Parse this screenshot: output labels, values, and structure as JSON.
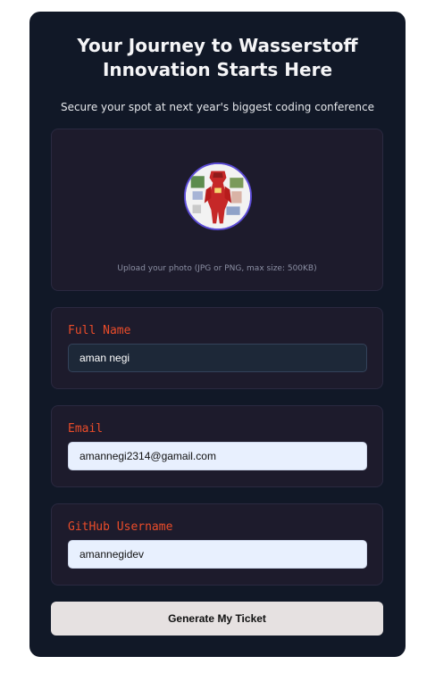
{
  "hero": {
    "title_line1": "Your Journey to Wasserstoff",
    "title_line2": "Innovation Starts Here",
    "subtitle": "Secure your spot at next year's biggest coding conference"
  },
  "upload": {
    "hint": "Upload your photo (JPG or PNG, max size: 500KB)"
  },
  "form": {
    "full_name": {
      "label": "Full Name",
      "value": "aman negi"
    },
    "email": {
      "label": "Email",
      "value": "amannegi2314@gamail.com"
    },
    "github": {
      "label": "GitHub Username",
      "value": "amannegidev"
    },
    "submit_label": "Generate My Ticket"
  },
  "colors": {
    "card_bg": "#111827",
    "panel_bg": "#1d1b2c",
    "label_accent": "#ea4c2a",
    "button_bg": "#e6e1e1"
  }
}
